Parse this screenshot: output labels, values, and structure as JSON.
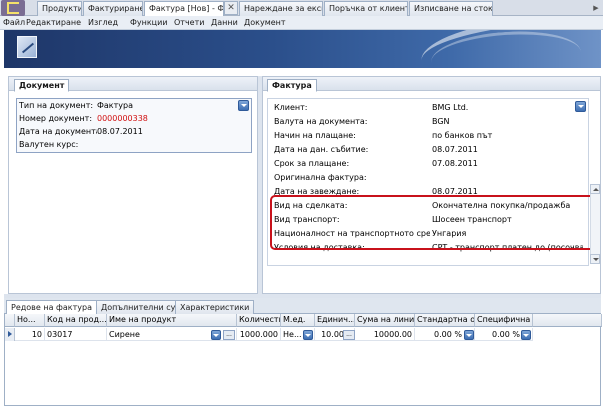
{
  "tabs": [
    {
      "label": "Продукти"
    },
    {
      "label": "Фактуриране*"
    },
    {
      "label": "Фактура [Нов] - Ф..."
    },
    {
      "label": "Нареждане за експ..."
    },
    {
      "label": "Поръчка от клиент..."
    },
    {
      "label": "Изписване на сток..."
    }
  ],
  "tab_close": "✕",
  "menu": [
    "Файл",
    "Редактиране",
    "Изглед",
    "Функции",
    "Отчети",
    "Данни",
    "Документ"
  ],
  "document_panel": {
    "tab": "Документ",
    "fields": [
      {
        "label": "Тип на документ:",
        "value": "Фактура"
      },
      {
        "label": "Номер документ:",
        "value": "0000000338"
      },
      {
        "label": "Дата на документа:",
        "value": "08.07.2011"
      },
      {
        "label": "Валутен курс:",
        "value": ""
      }
    ]
  },
  "invoice_panel": {
    "tab": "Фактура",
    "fields": [
      {
        "label": "Клиент:",
        "value": "BMG Ltd."
      },
      {
        "label": "Валута на документа:",
        "value": "BGN"
      },
      {
        "label": "Начин на плащане:",
        "value": "по банков път"
      },
      {
        "label": "Дата на дан. събитие:",
        "value": "08.07.2011"
      },
      {
        "label": "Срок за плащане:",
        "value": "07.08.2011"
      },
      {
        "label": "Оригинална фактура:",
        "value": ""
      },
      {
        "label": "Дата на завеждане:",
        "value": "08.07.2011"
      },
      {
        "label": "Вид на сделката:",
        "value": "Окончателна покупка/продажба"
      },
      {
        "label": "Вид транспорт:",
        "value": "Шосеен транспорт"
      },
      {
        "label": "Националност на транспортното средство:",
        "value": "Унгария"
      },
      {
        "label": "Условия на доставка:",
        "value": "CPT - транспорт платен до (посочва се мя..."
      }
    ]
  },
  "bottom_tabs": [
    "Редове на фактура",
    "Допълнителни суми",
    "Характеристики"
  ],
  "grid": {
    "columns": [
      "Но...",
      "Код на прод...",
      "Име на продукт",
      "Количество",
      "М.ед.",
      "Единич...",
      "Сума на линията",
      "Стандартна от...",
      "Специфична от..."
    ],
    "rows": [
      {
        "no": "10",
        "code": "03017",
        "name": "Сирене",
        "qty": "1000.000",
        "unit": "Не...",
        "price": "10.00",
        "sum": "10000.00",
        "std_disc": "0.00 %",
        "spec_disc": "0.00 %"
      }
    ],
    "ellipsis": "..."
  }
}
